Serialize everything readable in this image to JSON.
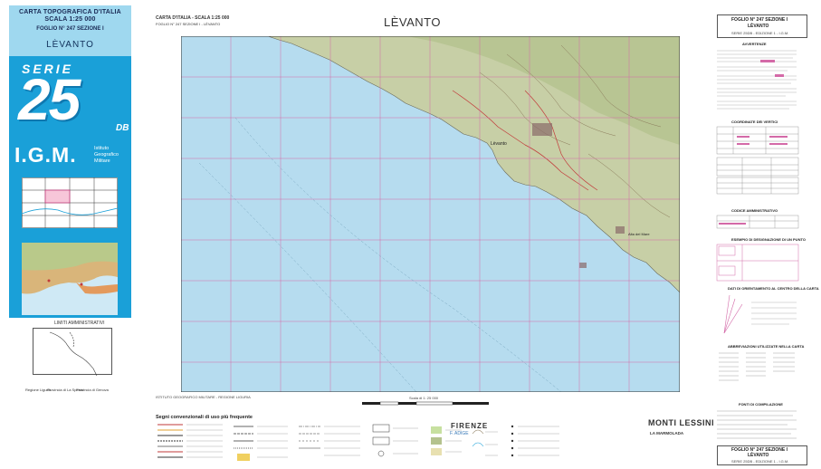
{
  "cover": {
    "title_line1": "CARTA TOPOGRAFICA D'ITALIA",
    "title_line2": "SCALA 1:25 000",
    "foglio": "FOGLIO N° 247  SEZIONE I",
    "name": "LÈVANTO",
    "serie": "SERIE",
    "number": "25",
    "suffix": "DB",
    "igm": "I.G.M.",
    "igm_line1": "Istituto",
    "igm_line2": "Geografico",
    "igm_line3": "Militare",
    "colors": {
      "cover_blue": "#1aa0d8",
      "cover_light": "#9fd8ef"
    }
  },
  "limiti": {
    "title": "LIMITI AMMINISTRATIVI",
    "labels": [
      "Regione Liguria",
      "Provincia di La Spezia",
      "Provincia di Genova"
    ]
  },
  "map": {
    "title": "LÈVANTO",
    "title_small_left": "CARTA D'ITALIA - SCALA 1:25 000",
    "title_small_sub": "FOGLIO N° 247  SEZIONE I - LÈVANTO",
    "town_label": "Lèvanto",
    "place_label": "Alta del Mare",
    "footer": "ISTITUTO GEOGRAFICO MILITARE - REGIONE LIGURIA",
    "scale": "Scala di 1: 25 000",
    "colors": {
      "sea": "#b6dcef",
      "land": "#c7cfa6",
      "grid": "#d46aa8"
    }
  },
  "legend": {
    "title": "Segni convenzionali di uso più frequente",
    "sample_city": "FIRENZE",
    "sample_river": "F. ADIGE",
    "sample_mountain": "MONTI LESSINI",
    "sample_lake": "LA MARMOLADA"
  },
  "right": {
    "foglio_top": "FOGLIO N° 247 SEZIONE I",
    "name_top": "LÈVANTO",
    "serie_top": "SERIE 25DB - EDIZIONE 1 - I.G.M.",
    "foglio_bottom": "FOGLIO N° 247 SEZIONE I",
    "name_bottom": "LÈVANTO",
    "serie_bottom": "SERIE 25DB - EDIZIONE 1 - I.G.M.",
    "section_titles": [
      "AVVERTENZE",
      "COORDINATE DEI VERTICI",
      "CODICE AMMINISTRATIVO",
      "ESEMPIO DI DESIGNAZIONE DI UN PUNTO",
      "DATI DI ORIENTAMENTO AL CENTRO DELLA CARTA",
      "ABBREVIAZIONI UTILIZZATE NELLA CARTA",
      "FONTI DI COMPILAZIONE"
    ]
  }
}
